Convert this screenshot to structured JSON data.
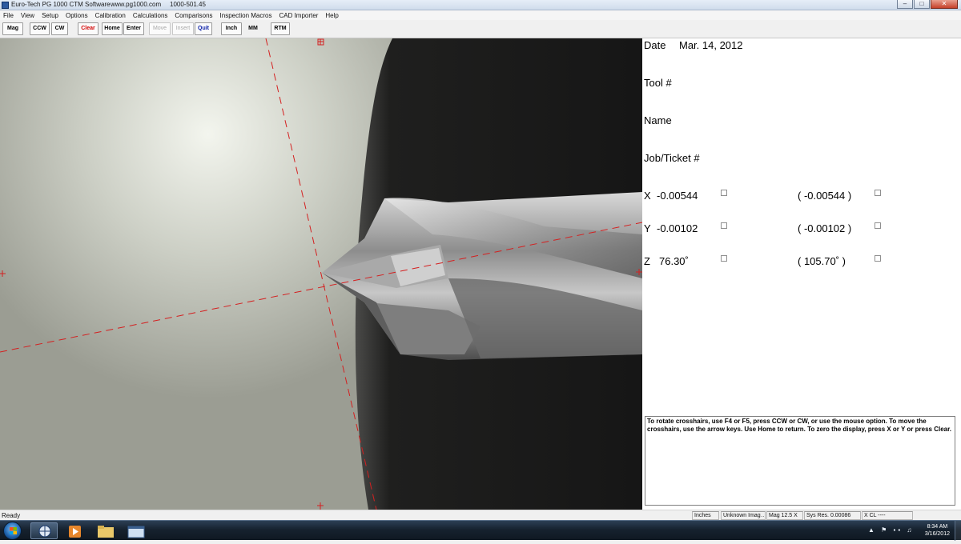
{
  "window": {
    "app_title": "Euro-Tech PG 1000 CTM Software",
    "website": "www.pg1000.com",
    "phone": "1000-501.45"
  },
  "menu": [
    "File",
    "View",
    "Setup",
    "Options",
    "Calibration",
    "Calculations",
    "Comparisons",
    "Inspection Macros",
    "CAD Importer",
    "Help"
  ],
  "toolbar": {
    "mag": "Mag",
    "ccw": "CCW",
    "cw": "CW",
    "clear": "Clear",
    "home": "Home",
    "enter": "Enter",
    "move": "Move",
    "insert": "Insert",
    "quit": "Quit",
    "inch": "Inch",
    "mm": "MM",
    "rtm": "RTM"
  },
  "info": {
    "date_label": "Date",
    "date_value": "Mar. 14, 2012",
    "tool_label": "Tool #",
    "name_label": "Name",
    "job_label": "Job/Ticket #"
  },
  "readout": {
    "x_label": "X",
    "x_value": "-0.00544",
    "x_alt": "( -0.00544 )",
    "y_label": "Y",
    "y_value": "-0.00102",
    "y_alt": "( -0.00102 )",
    "z_label": "Z",
    "z_value": "76.30˚",
    "z_alt": "( 105.70˚ )"
  },
  "help_text": "To rotate crosshairs, use F4 or F5, press CCW or CW, or use the mouse option.  To move the crosshairs, use the arrow keys.  Use Home to return.  To zero the display, press X or Y or press Clear.",
  "status": {
    "ready": "Ready",
    "units": "Inches",
    "image": "Unknown Imag…",
    "mag": "Mag 12.5 X",
    "sys_res": "Sys Res. 0.00086",
    "xcl": "X CL ----"
  },
  "taskbar": {
    "time": "8:34 AM",
    "date": "3/16/2012"
  },
  "colors": {
    "crosshair": "#d42020",
    "title_gradient": "#cfdcec",
    "taskbar": "#16222f"
  }
}
